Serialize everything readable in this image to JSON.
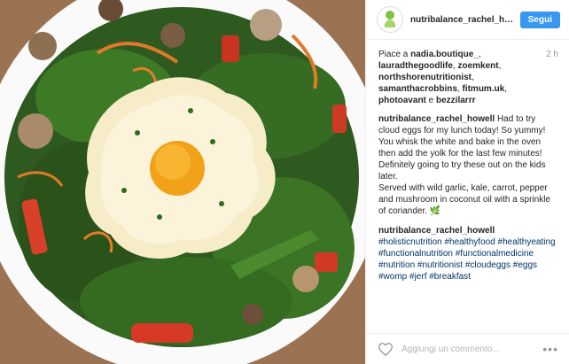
{
  "header": {
    "username": "nutribalance_rachel_ho...",
    "follow_label": "Segui",
    "avatar_icon": "nutribalance-logo-icon"
  },
  "likes": {
    "prefix": "Piace a",
    "user1": "nadia.boutique_",
    "user2": "lauradthegoodlife",
    "user3": "zoemkent",
    "user4": "northshorenutritionist",
    "user5": "samanthacrobbins",
    "user6": "fitmum.uk",
    "user7": "photoavant",
    "conj": "e",
    "user8": "bezzilarrr",
    "time": "2 h"
  },
  "caption": {
    "author": "nutribalance_rachel_howell",
    "text1": "Had to try cloud eggs for my lunch today! So yummy! You whisk the white and bake in the oven then add the yolk for the last few minutes! Definitely going to try these out on the kids later.",
    "text2": "Served with wild garlic, kale, carrot, pepper and mushroom in coconut oil with a sprinkle of coriander. 🌿"
  },
  "comment": {
    "author": "nutribalance_rachel_howell",
    "hashtags": "#holisticnutrition #healthyfood #healthyeating #functionalnutrition #functionalmedicine #nutrition #nutritionist #cloudeggs #eggs #womp #jerf #breakfast"
  },
  "footer": {
    "placeholder": "Aggiungi un commento...",
    "heart_icon": "heart-icon",
    "more_icon": "more-options-icon",
    "more_label": "•••"
  },
  "colors": {
    "follow": "#3897f0",
    "tag": "#003569",
    "text": "#262626"
  }
}
